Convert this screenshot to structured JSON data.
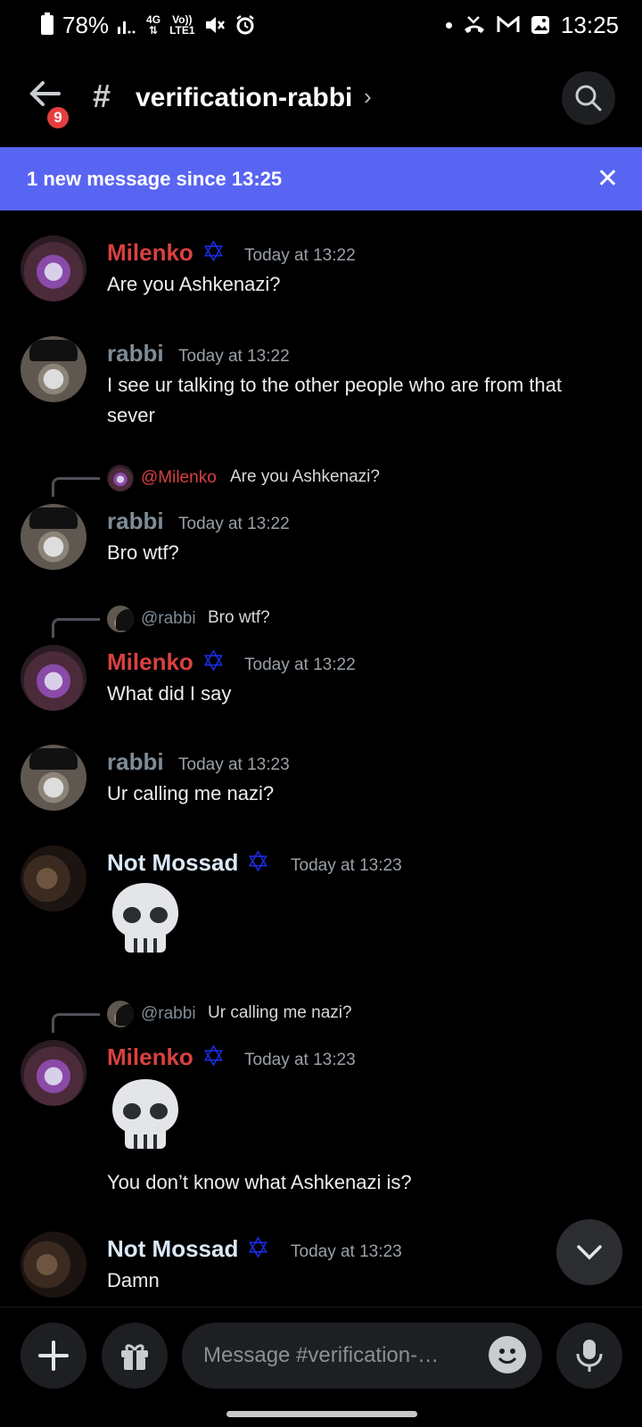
{
  "status_bar": {
    "battery": "78%",
    "network_top": "4G",
    "volte_top": "Vo))",
    "volte_bottom": "LTE1",
    "time": "13:25"
  },
  "header": {
    "channel_name": "verification-rabbi",
    "unread_badge": "9",
    "back_icon": "arrow-left-icon",
    "search_icon": "search-icon"
  },
  "banner": {
    "text": "1 new message since 13:25",
    "close_label": "✕"
  },
  "messages": [
    {
      "author": "Milenko",
      "time": "Today at 13:22",
      "text": "Are you Ashkenazi?"
    },
    {
      "author": "rabbi",
      "time": "Today at 13:22",
      "text": "I see ur talking to the other people who are from that sever"
    },
    {
      "reply_to": "@Milenko",
      "reply_text": "Are you Ashkenazi?",
      "author": "rabbi",
      "time": "Today at 13:22",
      "text": "Bro wtf?"
    },
    {
      "reply_to": "@rabbi",
      "reply_text": "Bro wtf?",
      "author": "Milenko",
      "time": "Today at 13:22",
      "text": "What did I say"
    },
    {
      "author": "rabbi",
      "time": "Today at 13:23",
      "text": "Ur calling me nazi?"
    },
    {
      "author": "Not Mossad",
      "time": "Today at 13:23",
      "emoji": "skull-icon"
    },
    {
      "reply_to": "@rabbi",
      "reply_text": "Ur calling me nazi?",
      "author": "Milenko",
      "time": "Today at 13:23",
      "emoji": "skull-icon",
      "text": "You don’t know what Ashkenazi is?"
    },
    {
      "author": "Not Mossad",
      "time": "Today at 13:23",
      "text": "Damn"
    }
  ],
  "composer": {
    "placeholder": "Message #verification-…"
  },
  "colors": {
    "banner": "#5865f2",
    "milenko": "#d94040",
    "rabbi": "#7f8c96",
    "mossad": "#dbe8f6",
    "star": "#1a2be0"
  }
}
